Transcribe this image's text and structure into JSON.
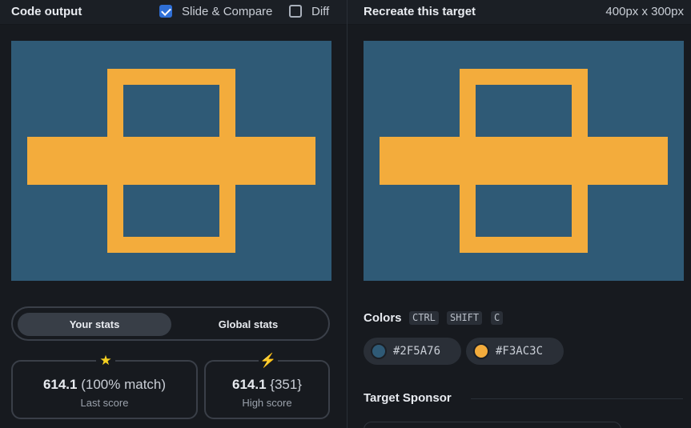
{
  "left_panel": {
    "title": "Code output",
    "slide_compare": {
      "label": "Slide & Compare",
      "checked": true
    },
    "diff": {
      "label": "Diff",
      "checked": false
    }
  },
  "right_panel": {
    "title": "Recreate this target",
    "dimensions": "400px x 300px"
  },
  "stats_tabs": {
    "your_stats": "Your stats",
    "global_stats": "Global stats",
    "active": "Your stats"
  },
  "stats": {
    "last": {
      "icon": "star-icon",
      "glyph": "★",
      "score": "614.1",
      "detail": "(100% match)",
      "label": "Last score"
    },
    "high": {
      "icon": "lightning-icon",
      "glyph": "⚡",
      "score": "614.1",
      "detail": "{351}",
      "label": "High score"
    }
  },
  "colors": {
    "label": "Colors",
    "shortcut": [
      "CTRL",
      "SHIFT",
      "C"
    ],
    "swatches": [
      {
        "hex": "#2F5A76",
        "color": "#2f5a76"
      },
      {
        "hex": "#F3AC3C",
        "color": "#f3ac3c"
      }
    ]
  },
  "sponsor": {
    "label": "Target Sponsor"
  },
  "palette": {
    "background": "#2f5a76",
    "shape": "#f3ac3c"
  }
}
